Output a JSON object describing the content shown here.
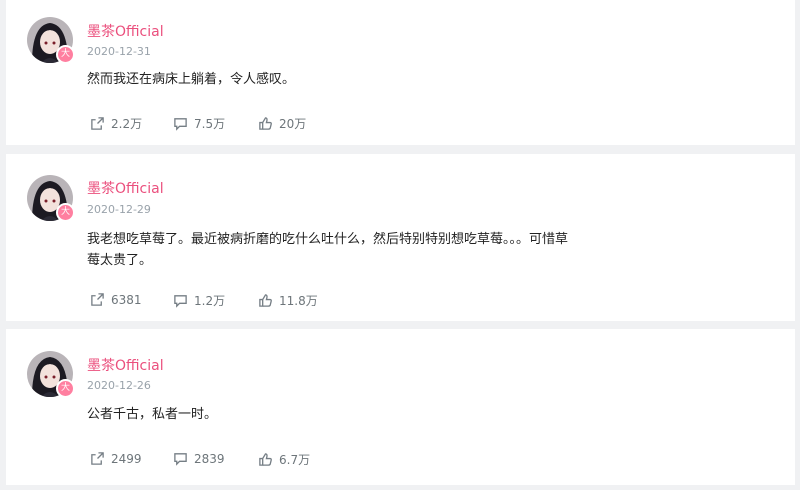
{
  "posts": [
    {
      "username": "墨茶Official",
      "date": "2020-12-31",
      "content": "然而我还在病床上躺着，令人感叹。",
      "shares": "2.2万",
      "comments": "7.5万",
      "likes": "20万"
    },
    {
      "username": "墨茶Official",
      "date": "2020-12-29",
      "content": "我老想吃草莓了。最近被病折磨的吃什么吐什么，然后特别特别想吃草莓。。。可惜草莓太贵了。",
      "shares": "6381",
      "comments": "1.2万",
      "likes": "11.8万"
    },
    {
      "username": "墨茶Official",
      "date": "2020-12-26",
      "content": "公者千古，私者一时。",
      "shares": "2499",
      "comments": "2839",
      "likes": "6.7万"
    }
  ],
  "avatar_badge": "大",
  "colors": {
    "username": "#eb507e",
    "meta": "#99a2aa",
    "action": "#6d757a",
    "background": "#f0f1f3"
  },
  "icons": {
    "share": "share-icon",
    "comment": "comment-icon",
    "like": "thumbs-up-icon"
  }
}
